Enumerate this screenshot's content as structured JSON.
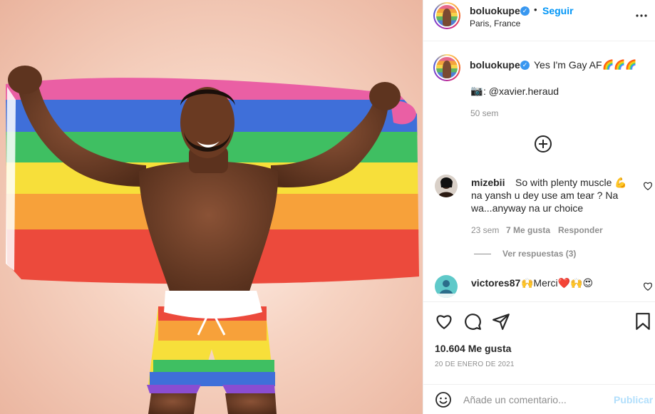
{
  "post": {
    "username": "boluokupe",
    "follow_label": "Seguir",
    "separator": "•",
    "location": "Paris, France",
    "verified_icon": "verified-badge-icon",
    "more_icon": "more-options-icon"
  },
  "caption": {
    "username": "boluokupe",
    "text": "Yes I'm Gay AF",
    "emojis": "🌈🌈🌈",
    "credit_icon": "📷",
    "credit_text": ":  @xavier.heraud",
    "age": "50 sem"
  },
  "load_more": {
    "icon": "plus-circle-icon"
  },
  "comments": [
    {
      "username": "mizebii",
      "lines": [
        "So with plenty muscle 💪",
        "na yansh u dey use am tear ? Na",
        "wa...anyway na ur choice"
      ],
      "age": "23 sem",
      "likes": "7 Me gusta",
      "reply_label": "Responder",
      "view_replies": "Ver respuestas (3)"
    },
    {
      "username": "victores87",
      "text": "🙌Merci❤️🙌😍"
    }
  ],
  "actions": {
    "like_icon": "heart-icon",
    "comment_icon": "comment-icon",
    "share_icon": "share-icon",
    "save_icon": "bookmark-icon",
    "likes_count": "10.604 Me gusta",
    "date": "20 DE ENERO DE 2021"
  },
  "add_comment": {
    "placeholder": "Añade un comentario...",
    "publish_label": "Publicar",
    "emoji_icon": "smiley-icon"
  },
  "colors": {
    "accent": "#0095f6",
    "publish_disabled": "#b2dffc",
    "verified": "#3897f0",
    "muted": "#8e8e8e",
    "text": "#262626"
  }
}
